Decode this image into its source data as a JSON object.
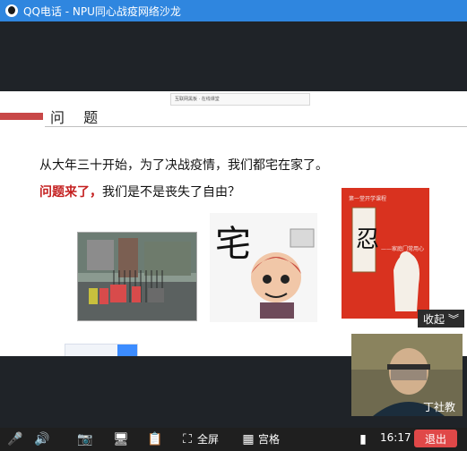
{
  "window": {
    "title": "QQ电话 - NPU同心战疫网络沙龙"
  },
  "slide": {
    "topic": "问 题",
    "line1": "从大年三十开始，为了决战疫情，我们都宅在家了。",
    "line2_red": "问题来了，",
    "line2_rest": "我们是不是丧失了自由？",
    "img2_char": "宅",
    "img3_top": "第一堂开学课程",
    "img3_char": "忍",
    "img3_side": "——家庭门常用心",
    "top_small": "互联网黑板 · 在线课堂",
    "bottom_search_placeholder": ""
  },
  "overlay": {
    "collapse": "收起"
  },
  "video": {
    "name": "丁社教"
  },
  "toolbar": {
    "fullscreen": "全屏",
    "grid": "宫格",
    "time": "16:17",
    "exit": "退出"
  }
}
